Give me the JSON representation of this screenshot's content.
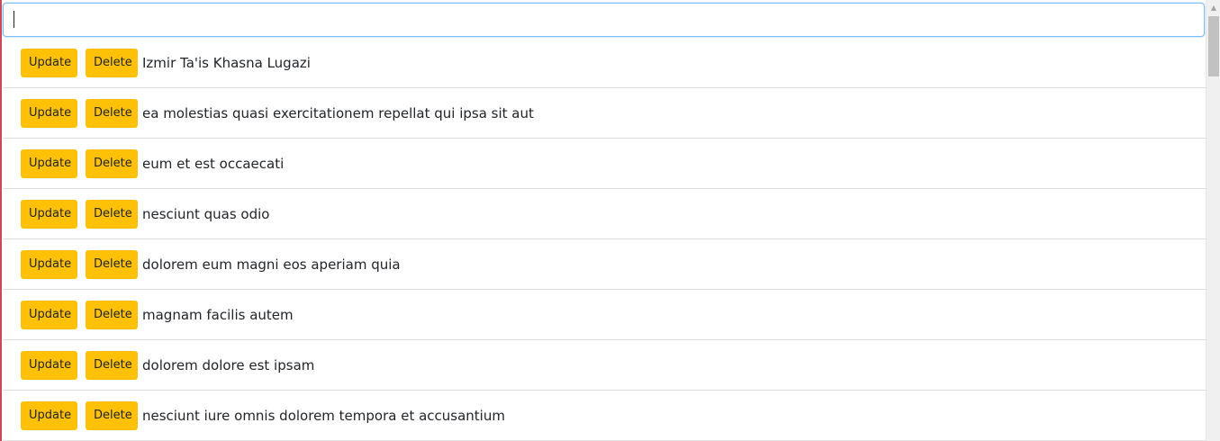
{
  "search": {
    "value": "",
    "placeholder": ""
  },
  "buttons": {
    "update_label": "Update",
    "delete_label": "Delete"
  },
  "items": [
    {
      "text": "Izmir Ta'is Khasna Lugazi"
    },
    {
      "text": "ea molestias quasi exercitationem repellat qui ipsa sit aut"
    },
    {
      "text": "eum et est occaecati"
    },
    {
      "text": "nesciunt quas odio"
    },
    {
      "text": "dolorem eum magni eos aperiam quia"
    },
    {
      "text": "magnam facilis autem"
    },
    {
      "text": "dolorem dolore est ipsam"
    },
    {
      "text": "nesciunt iure omnis dolorem tempora et accusantium"
    }
  ],
  "colors": {
    "button": "#ffc107",
    "input_focus_border": "#80bdff",
    "left_accent": "#c9485a"
  },
  "scrollbar": {
    "up_arrow_icon": "chevron-up-icon"
  }
}
